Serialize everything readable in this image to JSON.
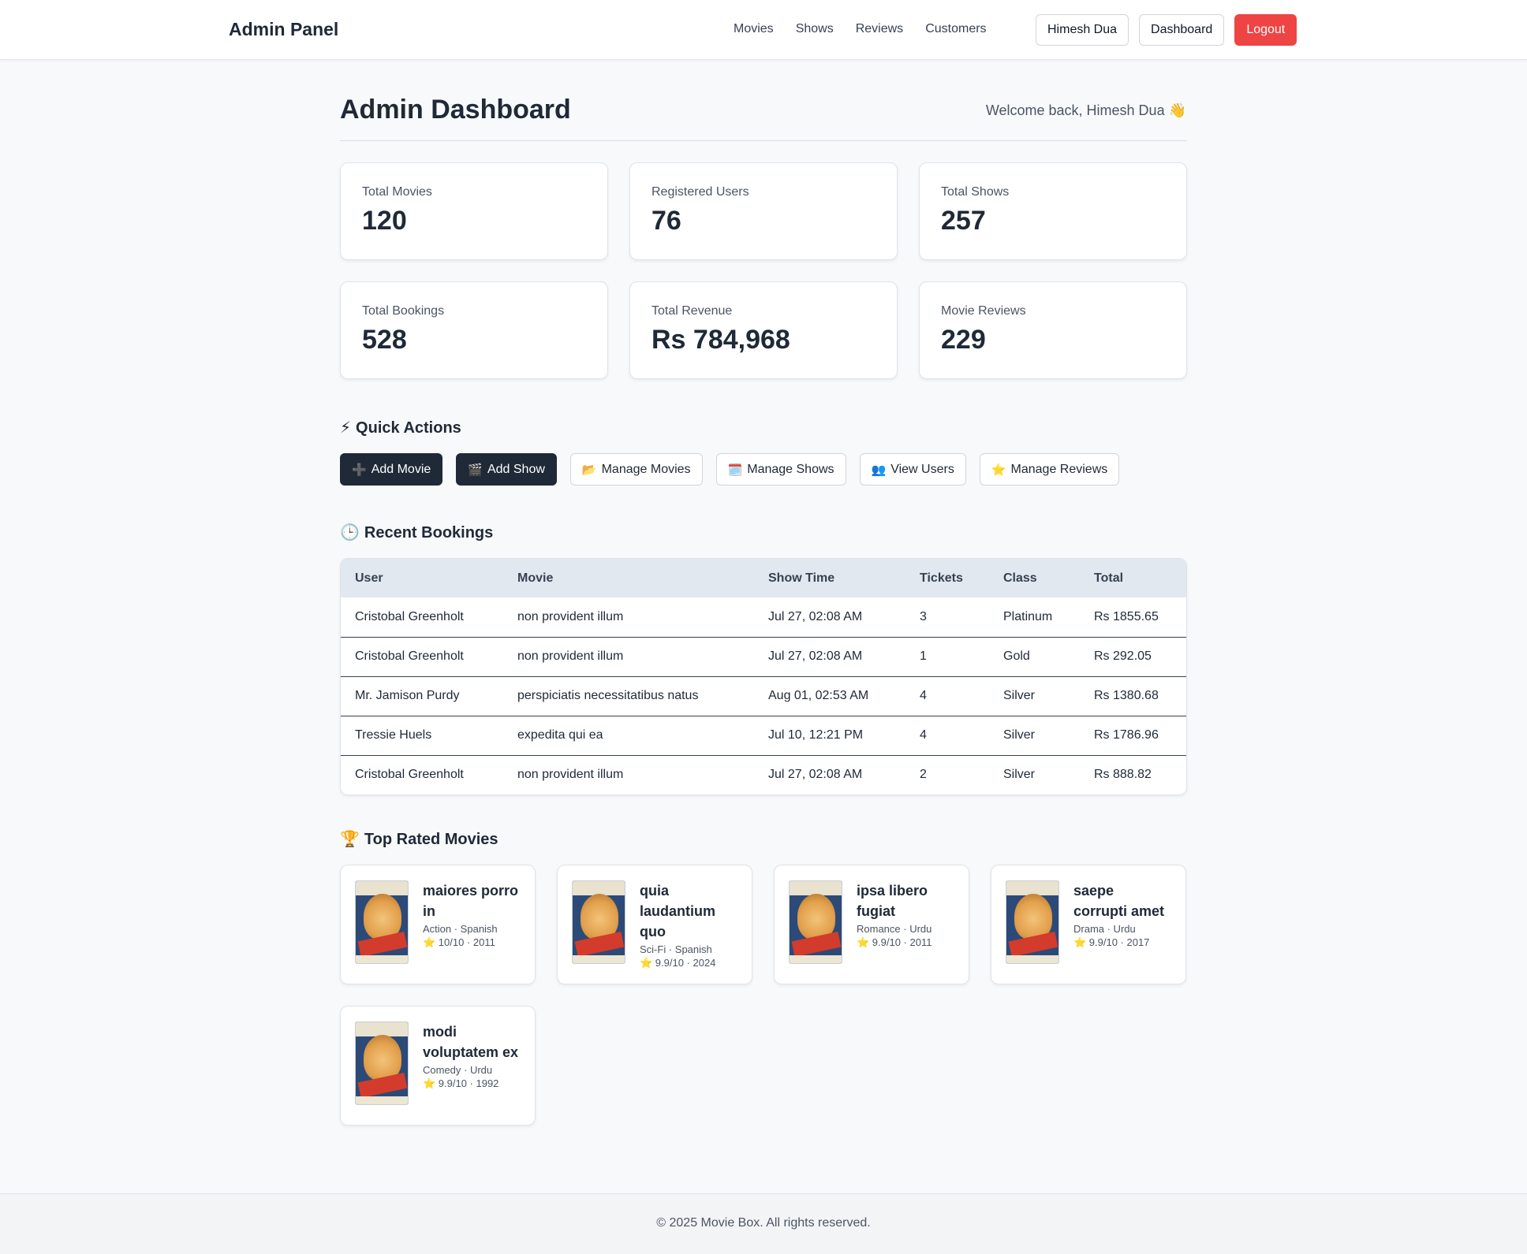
{
  "nav": {
    "brand": "Admin Panel",
    "links": [
      "Movies",
      "Shows",
      "Reviews",
      "Customers"
    ],
    "user_button": "Himesh Dua",
    "dashboard_button": "Dashboard",
    "logout_button": "Logout"
  },
  "header": {
    "title": "Admin Dashboard",
    "welcome": "Welcome back, Himesh Dua 👋"
  },
  "stats": [
    {
      "label": "Total Movies",
      "value": "120"
    },
    {
      "label": "Registered Users",
      "value": "76"
    },
    {
      "label": "Total Shows",
      "value": "257"
    },
    {
      "label": "Total Bookings",
      "value": "528"
    },
    {
      "label": "Total Revenue",
      "value": "Rs 784,968"
    },
    {
      "label": "Movie Reviews",
      "value": "229"
    }
  ],
  "quick_actions": {
    "title": "Quick Actions",
    "icon": "⚡",
    "buttons": [
      {
        "icon": "➕",
        "label": "Add Movie"
      },
      {
        "icon": "🎬",
        "label": "Add Show"
      },
      {
        "icon": "📂",
        "label": "Manage Movies"
      },
      {
        "icon": "🗓️",
        "label": "Manage Shows"
      },
      {
        "icon": "👥",
        "label": "View Users"
      },
      {
        "icon": "⭐",
        "label": "Manage Reviews"
      }
    ]
  },
  "recent_bookings": {
    "title": "Recent Bookings",
    "icon": "🕒",
    "columns": [
      "User",
      "Movie",
      "Show Time",
      "Tickets",
      "Class",
      "Total"
    ],
    "rows": [
      [
        "Cristobal Greenholt",
        "non provident illum",
        "Jul 27, 02:08 AM",
        "3",
        "Platinum",
        "Rs 1855.65"
      ],
      [
        "Cristobal Greenholt",
        "non provident illum",
        "Jul 27, 02:08 AM",
        "1",
        "Gold",
        "Rs 292.05"
      ],
      [
        "Mr. Jamison Purdy",
        "perspiciatis necessitatibus natus",
        "Aug 01, 02:53 AM",
        "4",
        "Silver",
        "Rs 1380.68"
      ],
      [
        "Tressie Huels",
        "expedita qui ea",
        "Jul 10, 12:21 PM",
        "4",
        "Silver",
        "Rs 1786.96"
      ],
      [
        "Cristobal Greenholt",
        "non provident illum",
        "Jul 27, 02:08 AM",
        "2",
        "Silver",
        "Rs 888.82"
      ]
    ]
  },
  "top_rated": {
    "title": "Top Rated Movies",
    "icon": "🏆",
    "movies": [
      {
        "title": "maiores porro in",
        "meta": "Action · Spanish",
        "rating": "⭐ 10/10 · 2011"
      },
      {
        "title": "quia laudantium quo",
        "meta": "Sci-Fi · Spanish",
        "rating": "⭐ 9.9/10 · 2024"
      },
      {
        "title": "ipsa libero fugiat",
        "meta": "Romance · Urdu",
        "rating": "⭐ 9.9/10 · 2011"
      },
      {
        "title": "saepe corrupti amet",
        "meta": "Drama · Urdu",
        "rating": "⭐ 9.9/10 · 2017"
      },
      {
        "title": "modi voluptatem ex",
        "meta": "Comedy · Urdu",
        "rating": "⭐ 9.9/10 · 1992"
      }
    ]
  },
  "footer": {
    "text": "© 2025 Movie Box. All rights reserved."
  },
  "colors": {
    "logout": "#ef4444",
    "dark_button": "#1f2937",
    "table_header": "#e2e8f0",
    "background": "#f8f9fb"
  }
}
